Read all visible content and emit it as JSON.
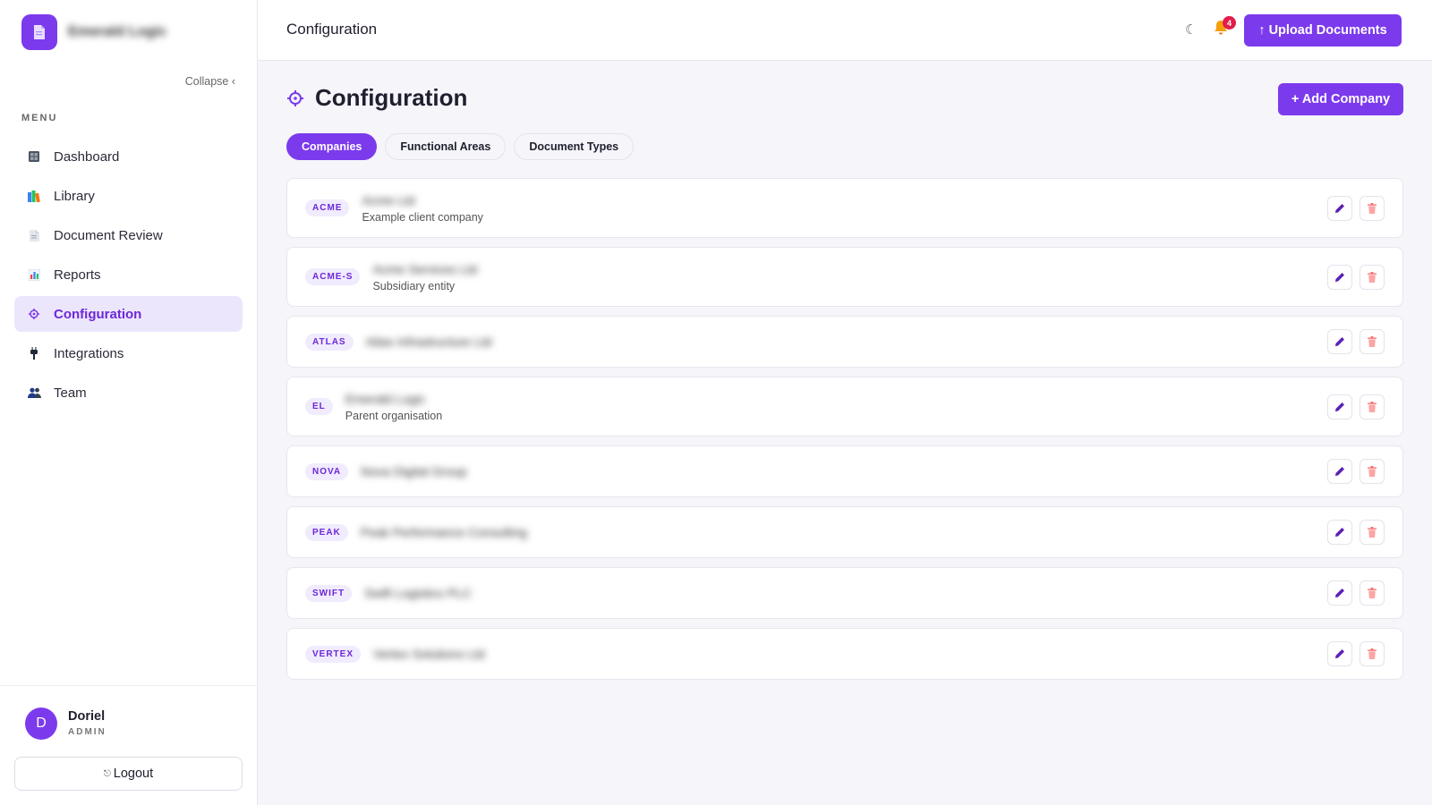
{
  "sidebar": {
    "brand_name": "Emerald Logic",
    "collapse_label": "Collapse ‹",
    "menu_title": "MENU",
    "items": [
      {
        "label": "Dashboard",
        "icon": "dashboard-icon"
      },
      {
        "label": "Library",
        "icon": "books-icon"
      },
      {
        "label": "Document Review",
        "icon": "document-icon"
      },
      {
        "label": "Reports",
        "icon": "bar-chart-icon"
      },
      {
        "label": "Configuration",
        "icon": "gear-icon",
        "active": true
      },
      {
        "label": "Integrations",
        "icon": "plug-icon"
      },
      {
        "label": "Team",
        "icon": "people-icon"
      }
    ],
    "user": {
      "initial": "D",
      "name": "Doriel",
      "role": "ADMIN"
    },
    "logout_label": "Logout"
  },
  "topbar": {
    "title": "Configuration",
    "notification_count": "4",
    "upload_label": "↑ Upload Documents"
  },
  "page": {
    "title": "Configuration",
    "add_company_label": "+ Add Company",
    "tabs": [
      {
        "label": "Companies",
        "active": true
      },
      {
        "label": "Functional Areas"
      },
      {
        "label": "Document Types"
      }
    ],
    "companies": [
      {
        "code": "ACME",
        "name": "Acme Ltd",
        "description": "Example client company"
      },
      {
        "code": "ACME-S",
        "name": "Acme Services Ltd",
        "description": "Subsidiary entity"
      },
      {
        "code": "ATLAS",
        "name": "Atlas Infrastructure Ltd",
        "description": ""
      },
      {
        "code": "EL",
        "name": "Emerald Logic",
        "description": "Parent organisation"
      },
      {
        "code": "NOVA",
        "name": "Nova Digital Group",
        "description": ""
      },
      {
        "code": "PEAK",
        "name": "Peak Performance Consulting",
        "description": ""
      },
      {
        "code": "SWIFT",
        "name": "Swift Logistics PLC",
        "description": ""
      },
      {
        "code": "VERTEX",
        "name": "Vertex Solutions Ltd",
        "description": ""
      }
    ]
  },
  "colors": {
    "accent": "#7c3aed",
    "accent_soft": "#ece6fd",
    "badge_red": "#e11d48",
    "delete_red": "#f87171",
    "bell_orange": "#f59e0b"
  }
}
